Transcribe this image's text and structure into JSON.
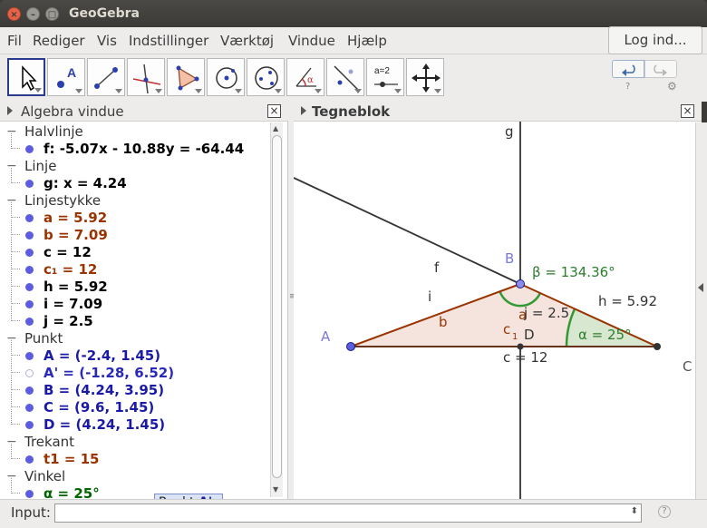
{
  "window": {
    "title": "GeoGebra"
  },
  "menu": {
    "items": [
      "Fil",
      "Rediger",
      "Vis",
      "Indstillinger",
      "Værktøj",
      "Vindue",
      "Hjælp"
    ],
    "login": "Log ind..."
  },
  "toolbar": {
    "tools": [
      "move-tool",
      "point-tool",
      "segment-tool",
      "perpendicular-line-tool",
      "polygon-tool",
      "circle-tool",
      "conic-tool",
      "angle-tool",
      "reflect-tool",
      "slider-tool",
      "move-graphics-tool"
    ],
    "slider_label": "a=2"
  },
  "algebra": {
    "title": "Algebra vindue",
    "categories": [
      {
        "name": "Halvlinje",
        "items": [
          {
            "text": "f: -5.07x - 10.88y = -64.44",
            "color": "black"
          }
        ]
      },
      {
        "name": "Linje",
        "items": [
          {
            "text": "g: x = 4.24",
            "color": "black"
          }
        ]
      },
      {
        "name": "Linjestykke",
        "items": [
          {
            "text": "a = 5.92",
            "color": "brown"
          },
          {
            "text": "b = 7.09",
            "color": "brown"
          },
          {
            "text": "c = 12",
            "color": "black"
          },
          {
            "text": "c₁ = 12",
            "color": "brown"
          },
          {
            "text": "h = 5.92",
            "color": "black"
          },
          {
            "text": "i = 7.09",
            "color": "black"
          },
          {
            "text": "j = 2.5",
            "color": "black"
          }
        ]
      },
      {
        "name": "Punkt",
        "items": [
          {
            "text": "A = (-2.4, 1.45)",
            "color": "blue"
          },
          {
            "text": "A' = (-1.28, 6.52)",
            "color": "lightblue"
          },
          {
            "text": "B = (4.24, 3.95)",
            "color": "blue"
          },
          {
            "text": "C = (9.6, 1.45)",
            "color": "blue"
          },
          {
            "text": "D = (4.24, 1.45)",
            "color": "blue"
          }
        ]
      },
      {
        "name": "Trekant",
        "items": [
          {
            "text": "t1 = 15",
            "color": "brown"
          }
        ]
      },
      {
        "name": "Vinkel",
        "items": [
          {
            "text": "α = 25°",
            "color": "green"
          }
        ]
      }
    ],
    "tooltip_prefix": "Punkt",
    "tooltip_name": "A'"
  },
  "graphics": {
    "title": "Tegneblok",
    "labels": {
      "g": "g",
      "B": "B",
      "A": "A",
      "C": "C",
      "D": "D",
      "f": "f",
      "i": "i",
      "b": "b",
      "a": "a",
      "c1": "c",
      "c1_sub": "1",
      "beta": "β = 134.36°",
      "h": "h = 5.92",
      "j": "j = 2.5",
      "alpha": "α = 25°",
      "c": "c = 12"
    }
  },
  "input": {
    "label": "Input:"
  },
  "colors": {
    "triangle_fill": "#f5e4de",
    "edge": "#993300",
    "angle_green": "#339933",
    "point": "#5c5ce0"
  }
}
